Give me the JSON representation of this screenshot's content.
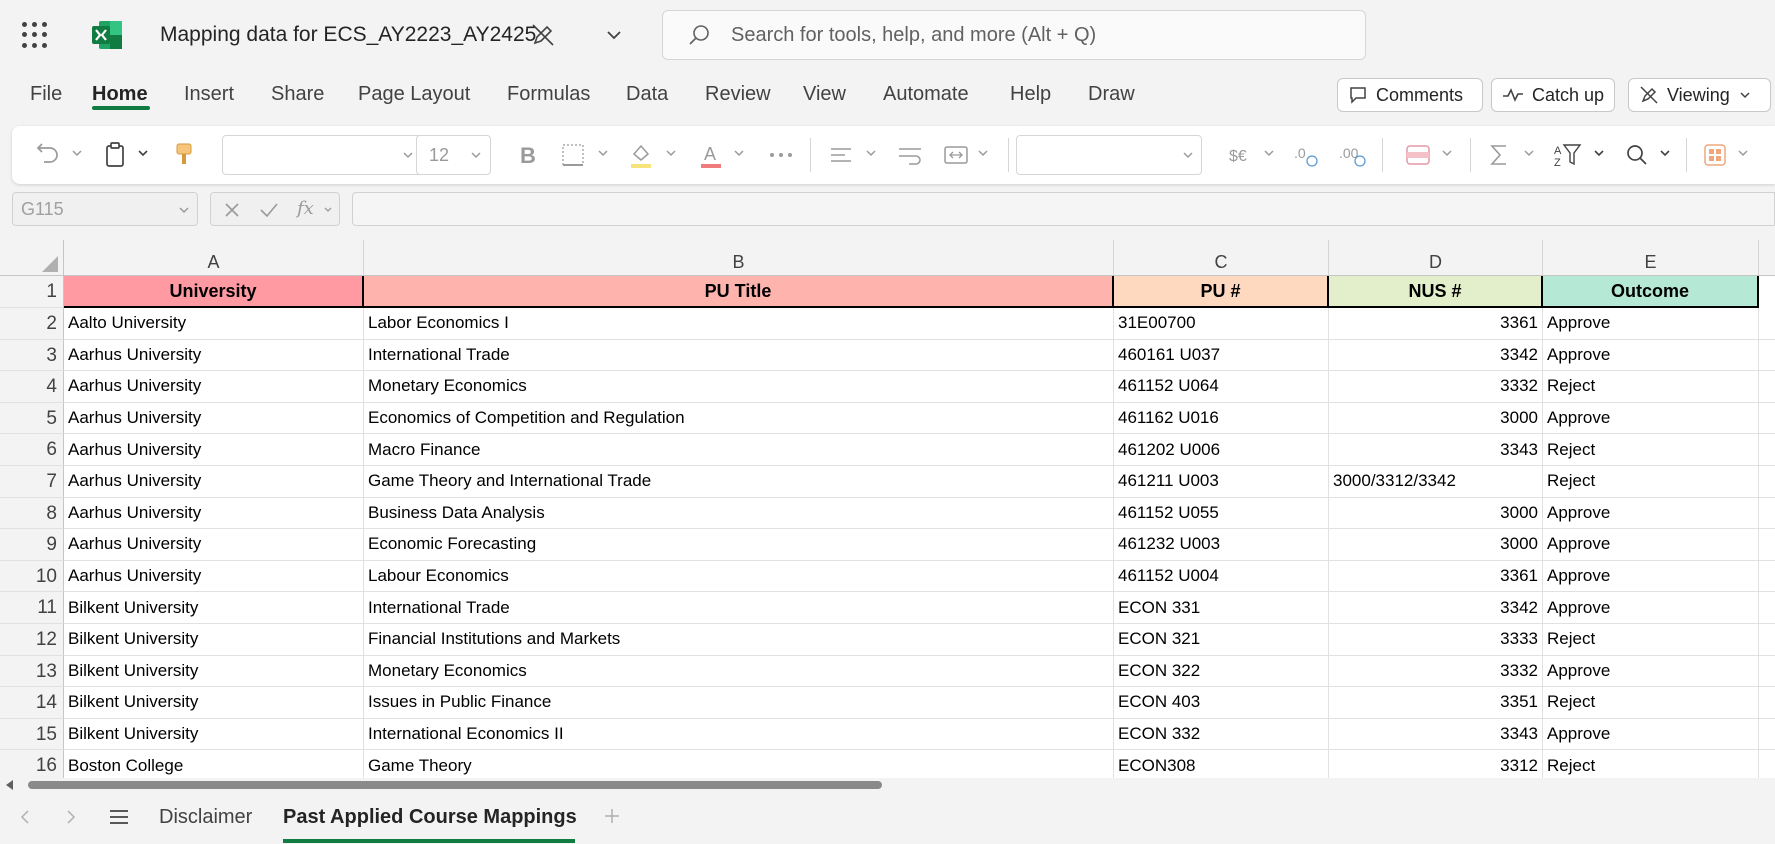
{
  "app": {
    "title": "Mapping data for ECS_AY2223_AY2425",
    "search_placeholder": "Search for tools, help, and more (Alt + Q)",
    "brand_color": "#107c41"
  },
  "menu": {
    "tabs": [
      "File",
      "Home",
      "Insert",
      "Share",
      "Page Layout",
      "Formulas",
      "Data",
      "Review",
      "View",
      "Automate",
      "Help",
      "Draw"
    ],
    "active": "Home",
    "comments_label": "Comments",
    "catchup_label": "Catch up",
    "viewing_label": "Viewing"
  },
  "ribbon": {
    "font_size": "12"
  },
  "formula_bar": {
    "name_box": "G115",
    "fx_label": "fx"
  },
  "grid": {
    "columns": [
      "A",
      "B",
      "C",
      "D",
      "E"
    ],
    "header_colors": [
      "#ff99a2",
      "#ffb3ad",
      "#ffd9bf",
      "#e3efcb",
      "#b6e8d6"
    ],
    "header": [
      "University",
      "PU Title",
      "PU #",
      "NUS #",
      "Outcome"
    ],
    "rows": [
      {
        "n": "2",
        "a": "Aalto University",
        "b": "Labor Economics I",
        "c": "31E00700",
        "d": "3361",
        "e": "Approve"
      },
      {
        "n": "3",
        "a": "Aarhus University",
        "b": "International Trade",
        "c": "460161 U037",
        "d": "3342",
        "e": "Approve"
      },
      {
        "n": "4",
        "a": "Aarhus University",
        "b": "Monetary Economics",
        "c": "461152 U064",
        "d": "3332",
        "e": "Reject"
      },
      {
        "n": "5",
        "a": "Aarhus University",
        "b": "Economics of Competition and Regulation",
        "c": "461162 U016",
        "d": "3000",
        "e": "Approve"
      },
      {
        "n": "6",
        "a": "Aarhus University",
        "b": "Macro Finance",
        "c": "461202 U006",
        "d": "3343",
        "e": "Reject"
      },
      {
        "n": "7",
        "a": "Aarhus University",
        "b": "Game Theory and International Trade",
        "c": "461211 U003",
        "d": "3000/3312/3342",
        "e": "Reject"
      },
      {
        "n": "8",
        "a": "Aarhus University",
        "b": "Business Data Analysis",
        "c": "461152 U055",
        "d": "3000",
        "e": "Approve"
      },
      {
        "n": "9",
        "a": "Aarhus University",
        "b": "Economic Forecasting",
        "c": "461232 U003",
        "d": "3000",
        "e": "Approve"
      },
      {
        "n": "10",
        "a": "Aarhus University",
        "b": "Labour Economics",
        "c": "461152 U004",
        "d": "3361",
        "e": "Approve"
      },
      {
        "n": "11",
        "a": "Bilkent University",
        "b": "International Trade",
        "c": "ECON 331",
        "d": "3342",
        "e": "Approve"
      },
      {
        "n": "12",
        "a": "Bilkent University",
        "b": "Financial Institutions and Markets",
        "c": "ECON 321",
        "d": "3333",
        "e": "Reject"
      },
      {
        "n": "13",
        "a": "Bilkent University",
        "b": "Monetary Economics",
        "c": "ECON 322",
        "d": "3332",
        "e": "Approve"
      },
      {
        "n": "14",
        "a": "Bilkent University",
        "b": "Issues in Public Finance",
        "c": "ECON 403",
        "d": "3351",
        "e": "Reject"
      },
      {
        "n": "15",
        "a": "Bilkent University",
        "b": "International Economics II",
        "c": "ECON 332",
        "d": "3343",
        "e": "Approve"
      },
      {
        "n": "16",
        "a": "Boston College",
        "b": "Game Theory",
        "c": "ECON308",
        "d": "3312",
        "e": "Reject"
      }
    ]
  },
  "sheets": {
    "tabs": [
      "Disclaimer",
      "Past Applied Course Mappings"
    ],
    "active": "Past Applied Course Mappings"
  }
}
